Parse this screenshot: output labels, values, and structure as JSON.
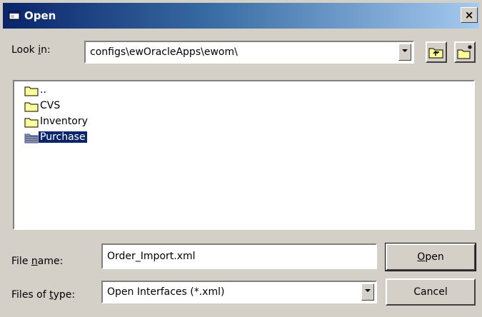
{
  "window": {
    "title": "Open",
    "close_glyph": "×"
  },
  "look_in": {
    "label_pre": "Look ",
    "label_accel": "i",
    "label_post": "n:",
    "value": "configs\\ewOracleApps\\ewom\\"
  },
  "toolbar": {
    "up_icon": "up-one-level-icon",
    "new_folder_icon": "new-folder-icon"
  },
  "file_list": {
    "items": [
      {
        "label": "..",
        "icon": "folder-icon",
        "selected": false
      },
      {
        "label": "CVS",
        "icon": "folder-icon",
        "selected": false
      },
      {
        "label": "Inventory",
        "icon": "folder-icon",
        "selected": false
      },
      {
        "label": "Purchase",
        "icon": "folder-icon",
        "selected": true
      }
    ]
  },
  "file_name": {
    "label_pre": "File ",
    "label_accel": "n",
    "label_post": "ame:",
    "value": "Order_Import.xml"
  },
  "file_type": {
    "label_pre": "Files of ",
    "label_accel": "t",
    "label_post": "ype:",
    "value": "Open Interfaces (*.xml)"
  },
  "buttons": {
    "open_accel": "O",
    "open_rest": "pen",
    "cancel": "Cancel"
  },
  "colors": {
    "title_bar_start": "#0a246a",
    "title_bar_end": "#a6caf0",
    "dialog_bg": "#d4d0c8",
    "selection_bg": "#0a246a",
    "folder_yellow": "#ffff99"
  }
}
